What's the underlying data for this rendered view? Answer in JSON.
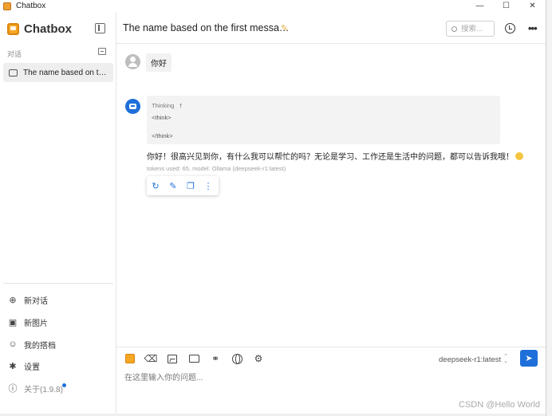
{
  "window": {
    "title": "Chatbox",
    "minimize": "—",
    "maximize": "☐",
    "close": "✕"
  },
  "sidebar": {
    "brand": "Chatbox",
    "section_label": "对话",
    "conversations": [
      {
        "label": "The name based on the first message"
      }
    ],
    "menu": {
      "new_chat": "新对话",
      "new_image": "新图片",
      "my_copilots": "我的搭档",
      "settings": "设置",
      "about": "关于(1.9.8)"
    }
  },
  "header": {
    "title": "The name based on the first messa…",
    "search_placeholder": "搜索...",
    "more": "•••"
  },
  "messages": {
    "user": {
      "text": "你好"
    },
    "assistant": {
      "thinking_label": "Thinking",
      "thinking_toggle": "↑",
      "think_open": "<think>",
      "think_close": "</think>",
      "text": "你好！很高兴见到你，有什么我可以帮忙的吗？无论是学习、工作还是生活中的问题，都可以告诉我哦！",
      "tokens": "tokens used: 65, model: Ollama (deepseek-r1:latest)"
    }
  },
  "input": {
    "model": "deepseek-r1:latest",
    "placeholder": "在这里输入你的问题..."
  },
  "watermark": "CSDN @Hello World",
  "colors": {
    "accent": "#1e6fd9",
    "brand": "#f5a623"
  }
}
